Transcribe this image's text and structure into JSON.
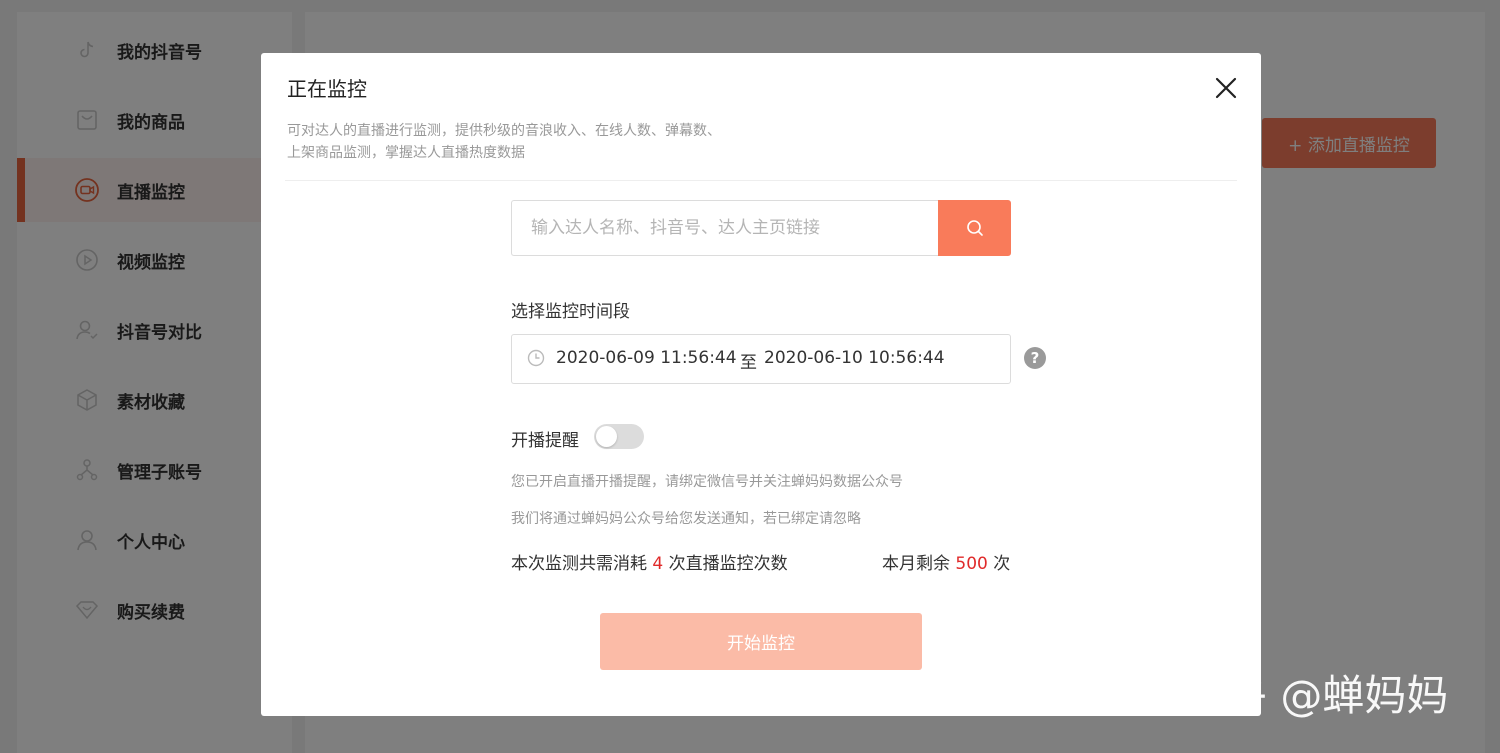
{
  "sidebar": {
    "items": [
      {
        "label": "我的抖音号",
        "icon": "tiktok-icon",
        "active": false
      },
      {
        "label": "我的商品",
        "icon": "bag-icon",
        "active": false
      },
      {
        "label": "直播监控",
        "icon": "live-camera-icon",
        "active": true
      },
      {
        "label": "视频监控",
        "icon": "play-circle-icon",
        "active": false
      },
      {
        "label": "抖音号对比",
        "icon": "user-compare-icon",
        "active": false
      },
      {
        "label": "素材收藏",
        "icon": "cube-icon",
        "active": false
      },
      {
        "label": "管理子账号",
        "icon": "tree-icon",
        "active": false
      },
      {
        "label": "个人中心",
        "icon": "user-icon",
        "active": false
      },
      {
        "label": "购买续费",
        "icon": "heart-diamond-icon",
        "active": false
      }
    ]
  },
  "main": {
    "add_button_label": "+ 添加直播监控"
  },
  "modal": {
    "title": "正在监控",
    "description_line1": "可对达人的直播进行监测，提供秒级的音浪收入、在线人数、弹幕数、",
    "description_line2": "上架商品监测，掌握达人直播热度数据",
    "search": {
      "placeholder": "输入达人名称、抖音号、达人主页链接",
      "value": ""
    },
    "time_range": {
      "label": "选择监控时间段",
      "start": "2020-06-09 11:56:44",
      "separator": "至",
      "end": "2020-06-10 10:56:44",
      "help": "?"
    },
    "reminder": {
      "label": "开播提醒",
      "enabled": false,
      "note1": "您已开启直播开播提醒，请绑定微信号并关注蝉妈妈数据公众号",
      "note2": "我们将通过蝉妈妈公众号给您发送通知，若已绑定请忽略"
    },
    "usage": {
      "prefix": "本次监测共需消耗",
      "count": "4",
      "suffix": "次直播监控次数"
    },
    "quota": {
      "prefix": "本月剩余",
      "count": "500",
      "suffix": "次"
    },
    "start_button_label": "开始监控"
  },
  "watermark": "知乎 @蝉妈妈",
  "colors": {
    "accent": "#f97b5a",
    "accent_disabled": "#fbbba7",
    "active_bar": "#e8653f",
    "highlight_number": "#e02a2a"
  }
}
